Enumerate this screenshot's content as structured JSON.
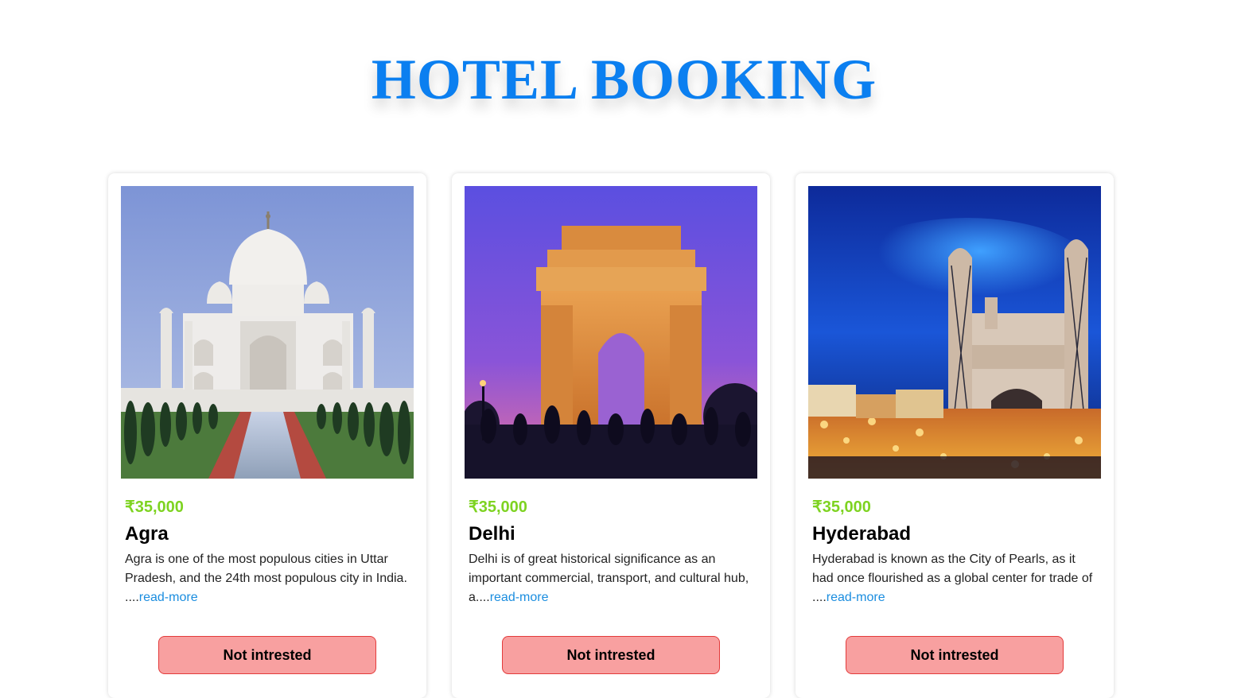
{
  "header": {
    "title": "HOTEL BOOKING",
    "title_color": "#0b7ff0"
  },
  "colors": {
    "price": "#7ed321",
    "link": "#1a8ddf",
    "button_bg": "#f8a0a0",
    "button_border": "#e33b3b"
  },
  "cards": [
    {
      "image": "taj-mahal-photo",
      "price": "₹35,000",
      "city": "Agra",
      "description": "Agra is one of the most populous cities in Uttar Pradesh, and the 24th most populous city in India. ....",
      "read_more": "read-more",
      "button_label": "Not intrested"
    },
    {
      "image": "india-gate-photo",
      "price": "₹35,000",
      "city": "Delhi",
      "description": "Delhi is of great historical significance as an important commercial, transport, and cultural hub, a....",
      "read_more": "read-more",
      "button_label": "Not intrested"
    },
    {
      "image": "charminar-photo",
      "price": "₹35,000",
      "city": "Hyderabad",
      "description": "Hyderabad is known as the City of Pearls, as it had once flourished as a global center for trade of ....",
      "read_more": "read-more",
      "button_label": "Not intrested"
    }
  ]
}
